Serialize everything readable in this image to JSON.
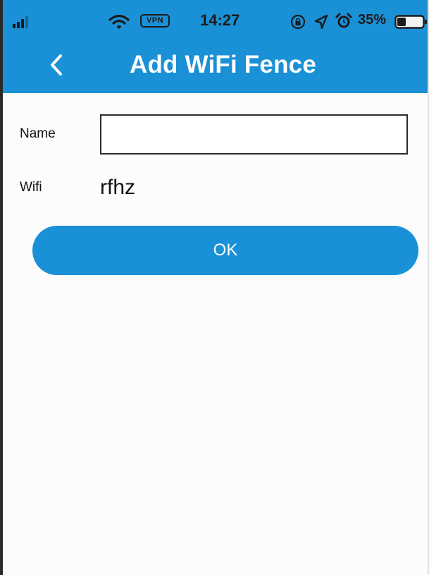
{
  "status_bar": {
    "vpn_label": "VPN",
    "time": "14:27",
    "battery_percent": "35%",
    "battery_level": 0.35,
    "icons": [
      "signal-icon",
      "wifi-icon",
      "lock-rotation-icon",
      "location-icon",
      "alarm-icon",
      "battery-icon"
    ]
  },
  "nav": {
    "title": "Add WiFi Fence",
    "back_icon": "chevron-left-icon"
  },
  "form": {
    "name_label": "Name",
    "name_value": "",
    "name_placeholder": "",
    "wifi_label": "Wifi",
    "wifi_value": "rfhz"
  },
  "actions": {
    "ok_label": "OK"
  },
  "colors": {
    "primary": "#1a90d6",
    "background": "#fcfcfc",
    "title_text": "#ffffff",
    "status_text": "#1b1b1b"
  }
}
